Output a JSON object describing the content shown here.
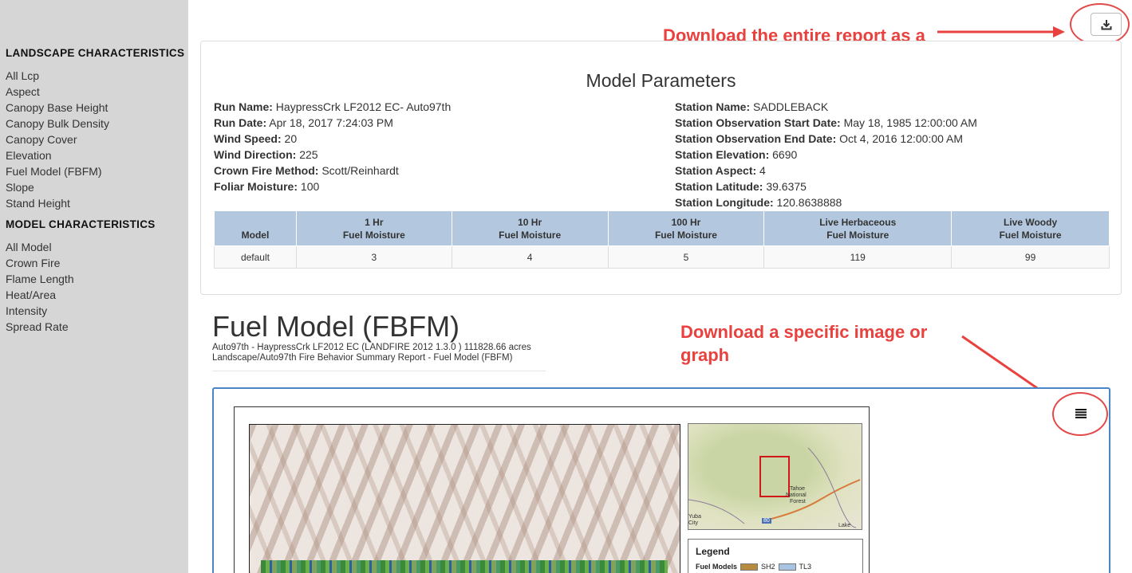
{
  "sidebar": {
    "landscape_heading": "LANDSCAPE CHARACTERISTICS",
    "landscape_items": [
      "All Lcp",
      "Aspect",
      "Canopy Base Height",
      "Canopy Bulk Density",
      "Canopy Cover",
      "Elevation",
      "Fuel Model (FBFM)",
      "Slope",
      "Stand Height"
    ],
    "model_heading": "MODEL CHARACTERISTICS",
    "model_items": [
      "All Model",
      "Crown Fire",
      "Flame Length",
      "Heat/Area",
      "Intensity",
      "Spread Rate"
    ]
  },
  "annotations": {
    "download_report": "Download the entire report as a PDF",
    "download_image": "Download a specific image or graph"
  },
  "model_parameters": {
    "title": "Model Parameters",
    "left": [
      {
        "label": "Run Name:",
        "value": "HaypressCrk LF2012 EC- Auto97th"
      },
      {
        "label": "Run Date:",
        "value": "Apr 18, 2017 7:24:03 PM"
      },
      {
        "label": "Wind Speed:",
        "value": "20"
      },
      {
        "label": "Wind Direction:",
        "value": "225"
      },
      {
        "label": "Crown Fire Method:",
        "value": "Scott/Reinhardt"
      },
      {
        "label": "Foliar Moisture:",
        "value": "100"
      }
    ],
    "right": [
      {
        "label": "Station Name:",
        "value": "SADDLEBACK"
      },
      {
        "label": "Station Observation Start Date:",
        "value": "May 18, 1985 12:00:00 AM"
      },
      {
        "label": "Station Observation End Date:",
        "value": "Oct 4, 2016 12:00:00 AM"
      },
      {
        "label": "Station Elevation:",
        "value": "6690"
      },
      {
        "label": "Station Aspect:",
        "value": "4"
      },
      {
        "label": "Station Latitude:",
        "value": "39.6375"
      },
      {
        "label": "Station Longitude:",
        "value": "120.8638888"
      }
    ],
    "table": {
      "headers": [
        [
          "Model"
        ],
        [
          "1 Hr",
          "Fuel Moisture"
        ],
        [
          "10 Hr",
          "Fuel Moisture"
        ],
        [
          "100 Hr",
          "Fuel Moisture"
        ],
        [
          "Live Herbaceous",
          "Fuel Moisture"
        ],
        [
          "Live Woody",
          "Fuel Moisture"
        ]
      ],
      "rows": [
        [
          "default",
          "3",
          "4",
          "5",
          "119",
          "99"
        ]
      ]
    }
  },
  "fuel_section": {
    "title": "Fuel Model (FBFM)",
    "subtitle_1": "Auto97th - HaypressCrk LF2012 EC (LANDFIRE 2012 1.3.0 ) 111828.66 acres",
    "subtitle_2": "Landscape/Auto97th Fire Behavior Summary Report - Fuel Model (FBFM)"
  },
  "inset_map": {
    "labels": [
      "Yuba",
      "City",
      "80",
      "Tahoe",
      "National",
      "Forest",
      "Lake"
    ]
  },
  "legend": {
    "title": "Legend",
    "row_label": "Fuel Models",
    "items": [
      {
        "code": "SH2",
        "color": "#b88c3f"
      },
      {
        "code": "TL3",
        "color": "#a9c4e3"
      }
    ]
  },
  "icons": {
    "download": "download-icon",
    "menu": "menu-icon"
  },
  "colors": {
    "annotation": "#e8413e",
    "table_header": "#b3c8df",
    "image_box_border": "#4a86c5"
  }
}
